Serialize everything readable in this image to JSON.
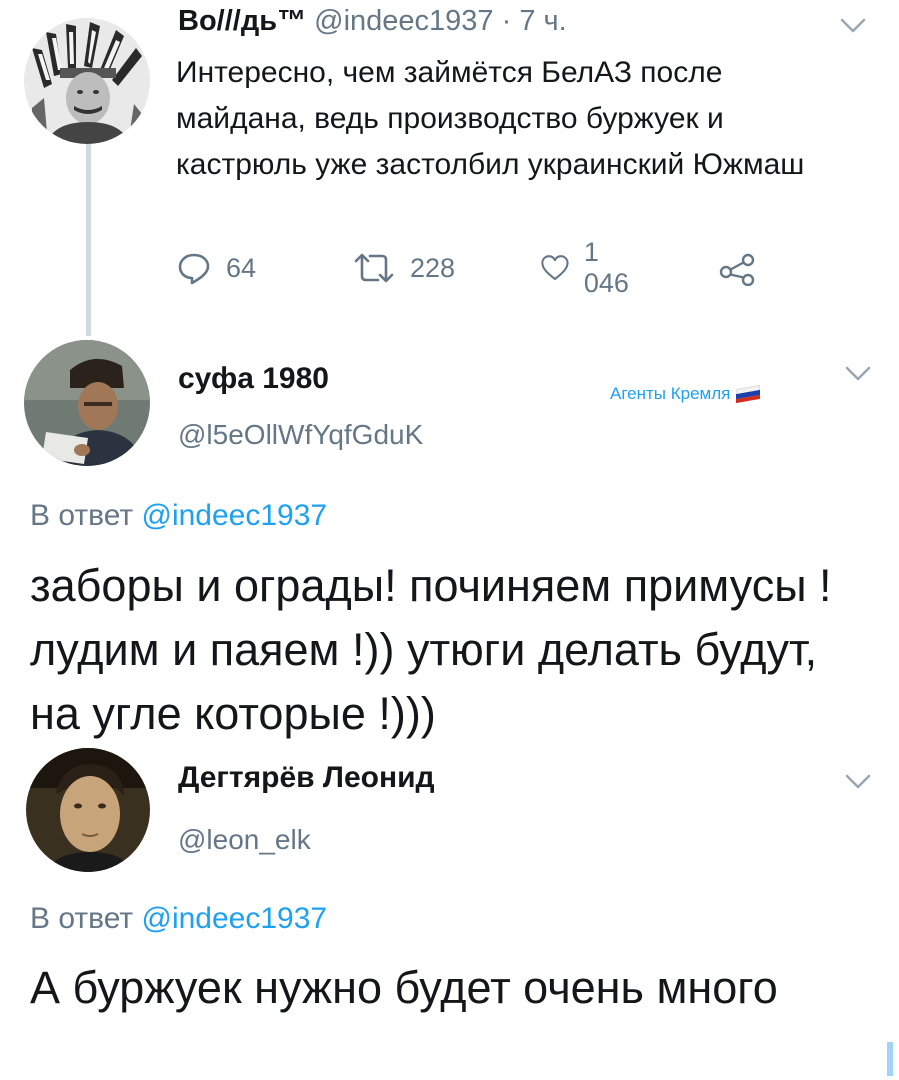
{
  "tweet1": {
    "name": "Во///дь™",
    "handle": "@indeec1937",
    "time": "· 7 ч.",
    "text": "Интересно, чем займётся БелАЗ после майдана, ведь производство буржуек и кастрюль уже застолбил украинский Южмаш",
    "replies": "64",
    "retweets": "228",
    "likes": "1 046"
  },
  "tweet2": {
    "name": "суфа 1980",
    "handle": "@l5eOllWfYqfGduK",
    "badge": "Агенты Кремля",
    "reply_prefix": "В ответ",
    "reply_handle": "@indeec1937",
    "text": "заборы и ограды! починяем примусы ! лудим и паяем !)) утюги делать будут, на угле которые !)))"
  },
  "tweet3": {
    "name": "Дегтярёв Леонид",
    "handle": "@leon_elk",
    "reply_prefix": "В ответ",
    "reply_handle": "@indeec1937",
    "text": "А буржуек нужно будет очень много"
  },
  "icons": {
    "reply": "reply-icon",
    "retweet": "retweet-icon",
    "like": "heart-icon",
    "share": "share-icon",
    "menu": "chevron-down-icon"
  },
  "colors": {
    "link": "#1da1f2",
    "muted": "#657786",
    "text": "#14171a",
    "thread_line": "#cfd9de",
    "flag_white": "#ffffff",
    "flag_blue": "#1c3fae",
    "flag_red": "#d52b1e"
  }
}
